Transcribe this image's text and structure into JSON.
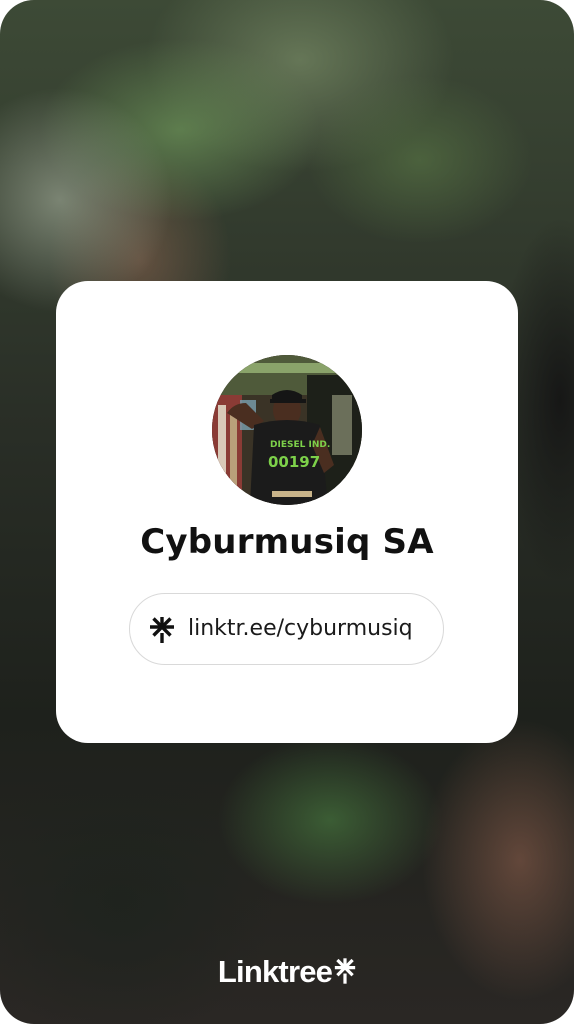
{
  "profile": {
    "name": "Cyburmusiq SA",
    "avatar_icon": "profile-photo",
    "shirt_text_line1": "DIESEL IND.",
    "shirt_text_line2": "00197"
  },
  "link": {
    "icon": "linktree-asterisk-icon",
    "url": "linktr.ee/cyburmusiq"
  },
  "footer": {
    "brand": "Linktree",
    "brand_icon": "linktree-asterisk-icon"
  },
  "colors": {
    "card": "#ffffff",
    "text": "#111111",
    "pill_border": "#d9d9d9",
    "brand_text": "#ffffff"
  }
}
